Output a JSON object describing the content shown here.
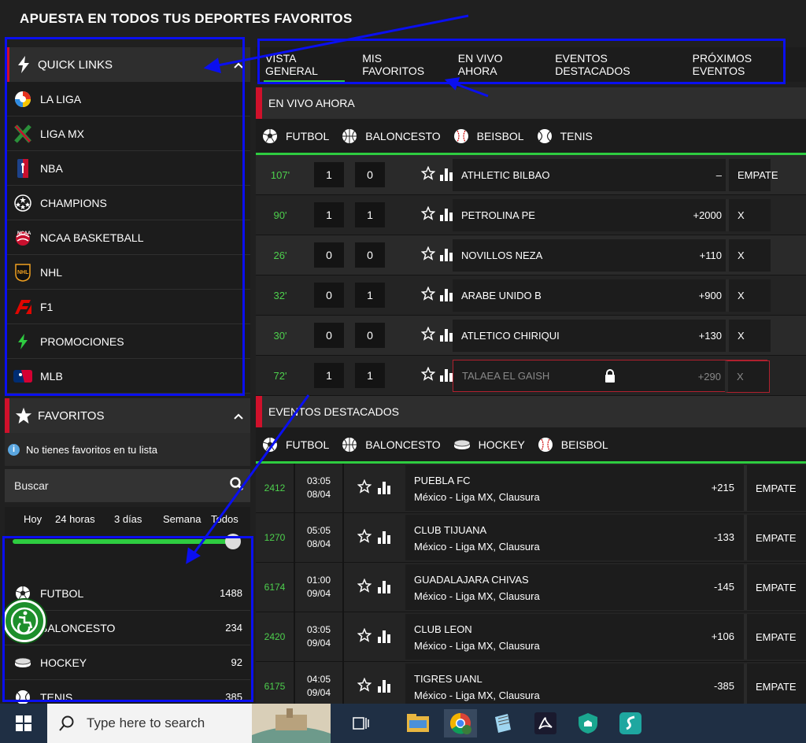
{
  "page_title": "APUESTA EN TODOS TUS DEPORTES FAVORITOS",
  "sidebar": {
    "quick_links_title": "QUICK LINKS",
    "quick_links": [
      {
        "label": "LA LIGA",
        "icon": "laliga-logo-icon"
      },
      {
        "label": "LIGA MX",
        "icon": "ligamx-logo-icon"
      },
      {
        "label": "NBA",
        "icon": "nba-logo-icon"
      },
      {
        "label": "CHAMPIONS",
        "icon": "champions-logo-icon"
      },
      {
        "label": "NCAA BASKETBALL",
        "icon": "ncaa-logo-icon"
      },
      {
        "label": "NHL",
        "icon": "nhl-logo-icon"
      },
      {
        "label": "F1",
        "icon": "f1-logo-icon"
      },
      {
        "label": "PROMOCIONES",
        "icon": "lightning-icon"
      },
      {
        "label": "MLB",
        "icon": "mlb-logo-icon"
      }
    ],
    "favorites_title": "FAVORITOS",
    "favorites_empty": "No tienes favoritos en tu lista",
    "search_placeholder": "Buscar",
    "ranges": [
      "Hoy",
      "24 horas",
      "3 días",
      "Semana",
      "Todos"
    ],
    "range_slider_value_fraction": 1.0,
    "sports": [
      {
        "label": "FUTBOL",
        "count": "1488",
        "icon": "soccer-ball-icon"
      },
      {
        "label": "BALONCESTO",
        "count": "234",
        "icon": "basketball-icon"
      },
      {
        "label": "HOCKEY",
        "count": "92",
        "icon": "hockey-puck-icon"
      },
      {
        "label": "TENIS",
        "count": "385",
        "icon": "tennis-ball-icon"
      }
    ]
  },
  "tabs": [
    "VISTA GENERAL",
    "MIS FAVORITOS",
    "EN VIVO AHORA",
    "EVENTOS DESTACADOS",
    "PRÓXIMOS EVENTOS"
  ],
  "live": {
    "title": "EN VIVO AHORA",
    "sports": [
      "FUTBOL",
      "BALONCESTO",
      "BEISBOL",
      "TENIS"
    ],
    "rows": [
      {
        "minute": "107'",
        "home": "1",
        "away": "0",
        "team": "ATHLETIC BILBAO",
        "odd": "–",
        "draw": "EMPATE",
        "locked": false
      },
      {
        "minute": "90'",
        "home": "1",
        "away": "1",
        "team": "PETROLINA PE",
        "odd": "+2000",
        "draw": "X",
        "locked": false
      },
      {
        "minute": "26'",
        "home": "0",
        "away": "0",
        "team": "NOVILLOS NEZA",
        "odd": "+110",
        "draw": "X",
        "locked": false
      },
      {
        "minute": "32'",
        "home": "0",
        "away": "1",
        "team": "ARABE UNIDO B",
        "odd": "+900",
        "draw": "X",
        "locked": false
      },
      {
        "minute": "30'",
        "home": "0",
        "away": "0",
        "team": "ATLETICO CHIRIQUI",
        "odd": "+130",
        "draw": "X",
        "locked": false
      },
      {
        "minute": "72'",
        "home": "1",
        "away": "1",
        "team": "TALAEA EL GAISH",
        "odd": "+290",
        "draw": "X",
        "locked": true
      }
    ]
  },
  "featured": {
    "title": "EVENTOS DESTACADOS",
    "sports": [
      "FUTBOL",
      "BALONCESTO",
      "HOCKEY",
      "BEISBOL"
    ],
    "rows": [
      {
        "id": "2412",
        "time": "03:05",
        "date": "08/04",
        "team": "PUEBLA FC",
        "league": "México - Liga MX, Clausura",
        "odd": "+215",
        "draw": "EMPATE"
      },
      {
        "id": "1270",
        "time": "05:05",
        "date": "08/04",
        "team": "CLUB TIJUANA",
        "league": "México - Liga MX, Clausura",
        "odd": "-133",
        "draw": "EMPATE"
      },
      {
        "id": "6174",
        "time": "01:00",
        "date": "09/04",
        "team": "GUADALAJARA CHIVAS",
        "league": "México - Liga MX, Clausura",
        "odd": "-145",
        "draw": "EMPATE"
      },
      {
        "id": "2420",
        "time": "03:05",
        "date": "09/04",
        "team": "CLUB LEON",
        "league": "México - Liga MX, Clausura",
        "odd": "+106",
        "draw": "EMPATE"
      },
      {
        "id": "6175",
        "time": "04:05",
        "date": "09/04",
        "team": "TIGRES UANL",
        "league": "México - Liga MX, Clausura",
        "odd": "-385",
        "draw": "EMPATE"
      }
    ]
  },
  "taskbar": {
    "search_placeholder": "Type here to search"
  },
  "colors": {
    "accent_red": "#d0112b",
    "accent_green": "#2ecc40",
    "annotation_blue": "#0a0ff0"
  }
}
